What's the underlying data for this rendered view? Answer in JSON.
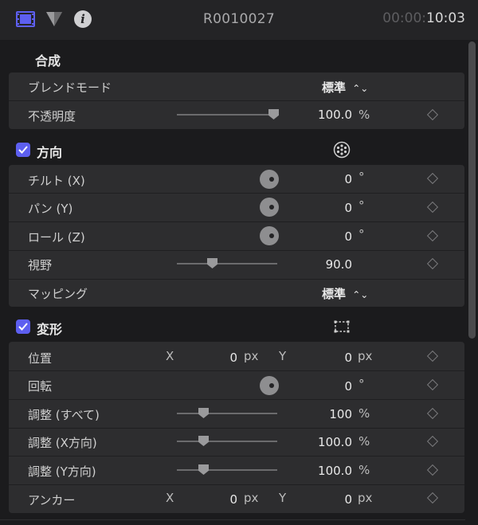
{
  "header": {
    "title": "R0010027",
    "timecode_dim": "00:00:",
    "timecode_bright": "10:03",
    "icons": [
      "video-inspector-icon",
      "color-inspector-icon",
      "info-inspector-icon"
    ]
  },
  "compositing": {
    "title": "合成",
    "blend_mode_label": "ブレンドモード",
    "blend_mode_value": "標準",
    "opacity_label": "不透明度",
    "opacity_value": "100.0",
    "opacity_unit": "%",
    "opacity_fraction": 1.0
  },
  "orientation": {
    "title": "方向",
    "checked": true,
    "tilt_label": "チルト (X)",
    "tilt_value": "0",
    "tilt_unit": "°",
    "pan_label": "パン (Y)",
    "pan_value": "0",
    "pan_unit": "°",
    "roll_label": "ロール (Z)",
    "roll_value": "0",
    "roll_unit": "°",
    "fov_label": "視野",
    "fov_value": "90.0",
    "mapping_label": "マッピング",
    "mapping_value": "標準"
  },
  "transform": {
    "title": "変形",
    "checked": true,
    "position_label": "位置",
    "position_x_axis": "X",
    "position_x_value": "0",
    "position_x_unit": "px",
    "position_y_axis": "Y",
    "position_y_value": "0",
    "position_y_unit": "px",
    "rotation_label": "回転",
    "rotation_value": "0",
    "rotation_unit": "°",
    "scale_all_label": "調整 (すべて)",
    "scale_all_value": "100",
    "scale_all_unit": "%",
    "scale_x_label": "調整 (X方向)",
    "scale_x_value": "100.0",
    "scale_x_unit": "%",
    "scale_y_label": "調整 (Y方向)",
    "scale_y_value": "100.0",
    "scale_y_unit": "%",
    "anchor_label": "アンカー",
    "anchor_x_axis": "X",
    "anchor_x_value": "0",
    "anchor_x_unit": "px",
    "anchor_y_axis": "Y",
    "anchor_y_value": "0",
    "anchor_y_unit": "px"
  },
  "colors": {
    "accent": "#5d5ff0",
    "background": "#1b1b1d",
    "row_bg": "#2d2d2f"
  }
}
